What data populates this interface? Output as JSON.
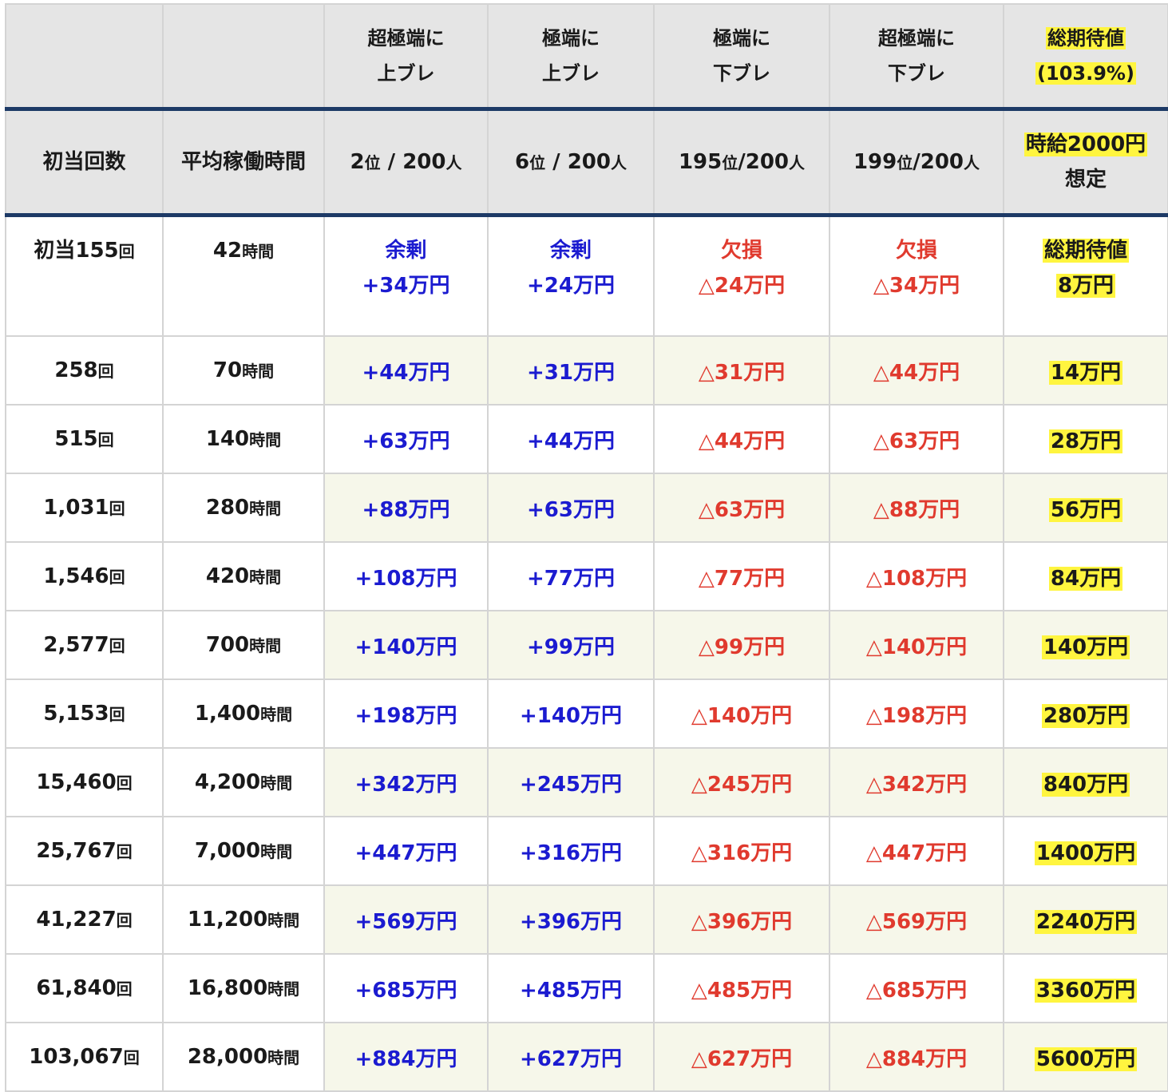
{
  "header1": {
    "col3": [
      "超極端に",
      "上ブレ"
    ],
    "col4": [
      "極端に",
      "上ブレ"
    ],
    "col5": [
      "極端に",
      "下ブレ"
    ],
    "col6": [
      "超極端に",
      "下ブレ"
    ],
    "col7": [
      "総期待値",
      "(103.9%)"
    ]
  },
  "header2": {
    "col1": "初当回数",
    "col2": "平均稼働時間",
    "col3": [
      "2",
      "位",
      " / 200",
      "人"
    ],
    "col4": [
      "6",
      "位",
      " / 200",
      "人"
    ],
    "col5": [
      "195",
      "位",
      "/200",
      "人"
    ],
    "col6": [
      "199",
      "位",
      "/200",
      "人"
    ],
    "col7": [
      "時給2000円",
      "想定"
    ]
  },
  "first_row": {
    "hits": "初当155",
    "hits_unit": "回",
    "hours": "42",
    "hours_unit": "時間",
    "c3": [
      "余剰",
      "+34万円"
    ],
    "c4": [
      "余剰",
      "+24万円"
    ],
    "c5": [
      "欠損",
      "△24万円"
    ],
    "c6": [
      "欠損",
      "△34万円"
    ],
    "c7": [
      "総期待値",
      "8万円"
    ]
  },
  "units": {
    "hits": "回",
    "hours": "時間"
  },
  "rows": [
    {
      "hits": "258",
      "hours": "70",
      "c3": "+44万円",
      "c4": "+31万円",
      "c5": "△31万円",
      "c6": "△44万円",
      "c7": "14万円"
    },
    {
      "hits": "515",
      "hours": "140",
      "c3": "+63万円",
      "c4": "+44万円",
      "c5": "△44万円",
      "c6": "△63万円",
      "c7": "28万円"
    },
    {
      "hits": "1,031",
      "hours": "280",
      "c3": "+88万円",
      "c4": "+63万円",
      "c5": "△63万円",
      "c6": "△88万円",
      "c7": "56万円"
    },
    {
      "hits": "1,546",
      "hours": "420",
      "c3": "+108万円",
      "c4": "+77万円",
      "c5": "△77万円",
      "c6": "△108万円",
      "c7": "84万円"
    },
    {
      "hits": "2,577",
      "hours": "700",
      "c3": "+140万円",
      "c4": "+99万円",
      "c5": "△99万円",
      "c6": "△140万円",
      "c7": "140万円"
    },
    {
      "hits": "5,153",
      "hours": "1,400",
      "c3": "+198万円",
      "c4": "+140万円",
      "c5": "△140万円",
      "c6": "△198万円",
      "c7": "280万円"
    },
    {
      "hits": "15,460",
      "hours": "4,200",
      "c3": "+342万円",
      "c4": "+245万円",
      "c5": "△245万円",
      "c6": "△342万円",
      "c7": "840万円"
    },
    {
      "hits": "25,767",
      "hours": "7,000",
      "c3": "+447万円",
      "c4": "+316万円",
      "c5": "△316万円",
      "c6": "△447万円",
      "c7": "1400万円"
    },
    {
      "hits": "41,227",
      "hours": "11,200",
      "c3": "+569万円",
      "c4": "+396万円",
      "c5": "△396万円",
      "c6": "△569万円",
      "c7": "2240万円"
    },
    {
      "hits": "61,840",
      "hours": "16,800",
      "c3": "+685万円",
      "c4": "+485万円",
      "c5": "△485万円",
      "c6": "△685万円",
      "c7": "3360万円"
    },
    {
      "hits": "103,067",
      "hours": "28,000",
      "c3": "+884万円",
      "c4": "+627万円",
      "c5": "△627万円",
      "c6": "△884万円",
      "c7": "5600万円"
    }
  ],
  "colors": {
    "header_bg": "#e5e5e5",
    "header_rule": "#1d3a66",
    "surplus_text": "#1b1bd0",
    "deficit_text": "#e03a2e",
    "highlight": "#fff53f",
    "shaded_row": "#f6f7ea"
  }
}
